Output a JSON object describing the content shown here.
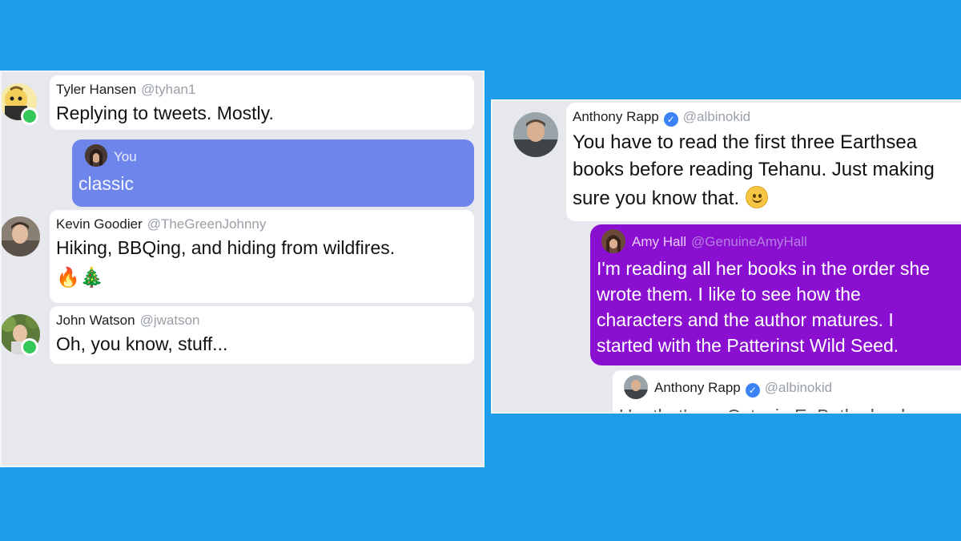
{
  "colors": {
    "background": "#1c9ce9",
    "panel": "#e6e8ed",
    "bubble": "#ffffff",
    "you_bubble": "#6e86ec",
    "amy_bubble": "#8a0fd0",
    "presence": "#34c759",
    "verified": "#3b82f6"
  },
  "left": {
    "tyler": {
      "name": "Tyler Hansen",
      "handle": "@tyhan1",
      "message": "Replying to tweets. Mostly.",
      "online": true
    },
    "you": {
      "name": "You",
      "message": "classic"
    },
    "kevin": {
      "name": "Kevin Goodier",
      "handle": "@TheGreenJohnny",
      "message": "Hiking, BBQing, and hiding from wildfires.",
      "emoji": "🔥🎄"
    },
    "john": {
      "name": "John Watson",
      "handle": "@jwatson",
      "message": "Oh, you know, stuff...",
      "online": true
    }
  },
  "right": {
    "anthony": {
      "name": "Anthony Rapp",
      "handle": "@albinokid",
      "verified": true,
      "lines": [
        "You have to read the first three Earthsea",
        "books before reading Tehanu. Just making",
        "sure you know that."
      ],
      "emoji_icon": "slightly-smiling-face-icon"
    },
    "amy": {
      "name": "Amy Hall",
      "handle": "@GenuineAmyHall",
      "lines": [
        "I'm reading all her books in the order she",
        "wrote them.  I like to see how the",
        "characters and the author matures.  I",
        "started with the Patterinst Wild Seed."
      ]
    },
    "anthony_reply": {
      "name": "Anthony Rapp",
      "handle": "@albinokid",
      "verified": true,
      "partial_text": "Um that's an Octavia E. Butler book"
    }
  }
}
